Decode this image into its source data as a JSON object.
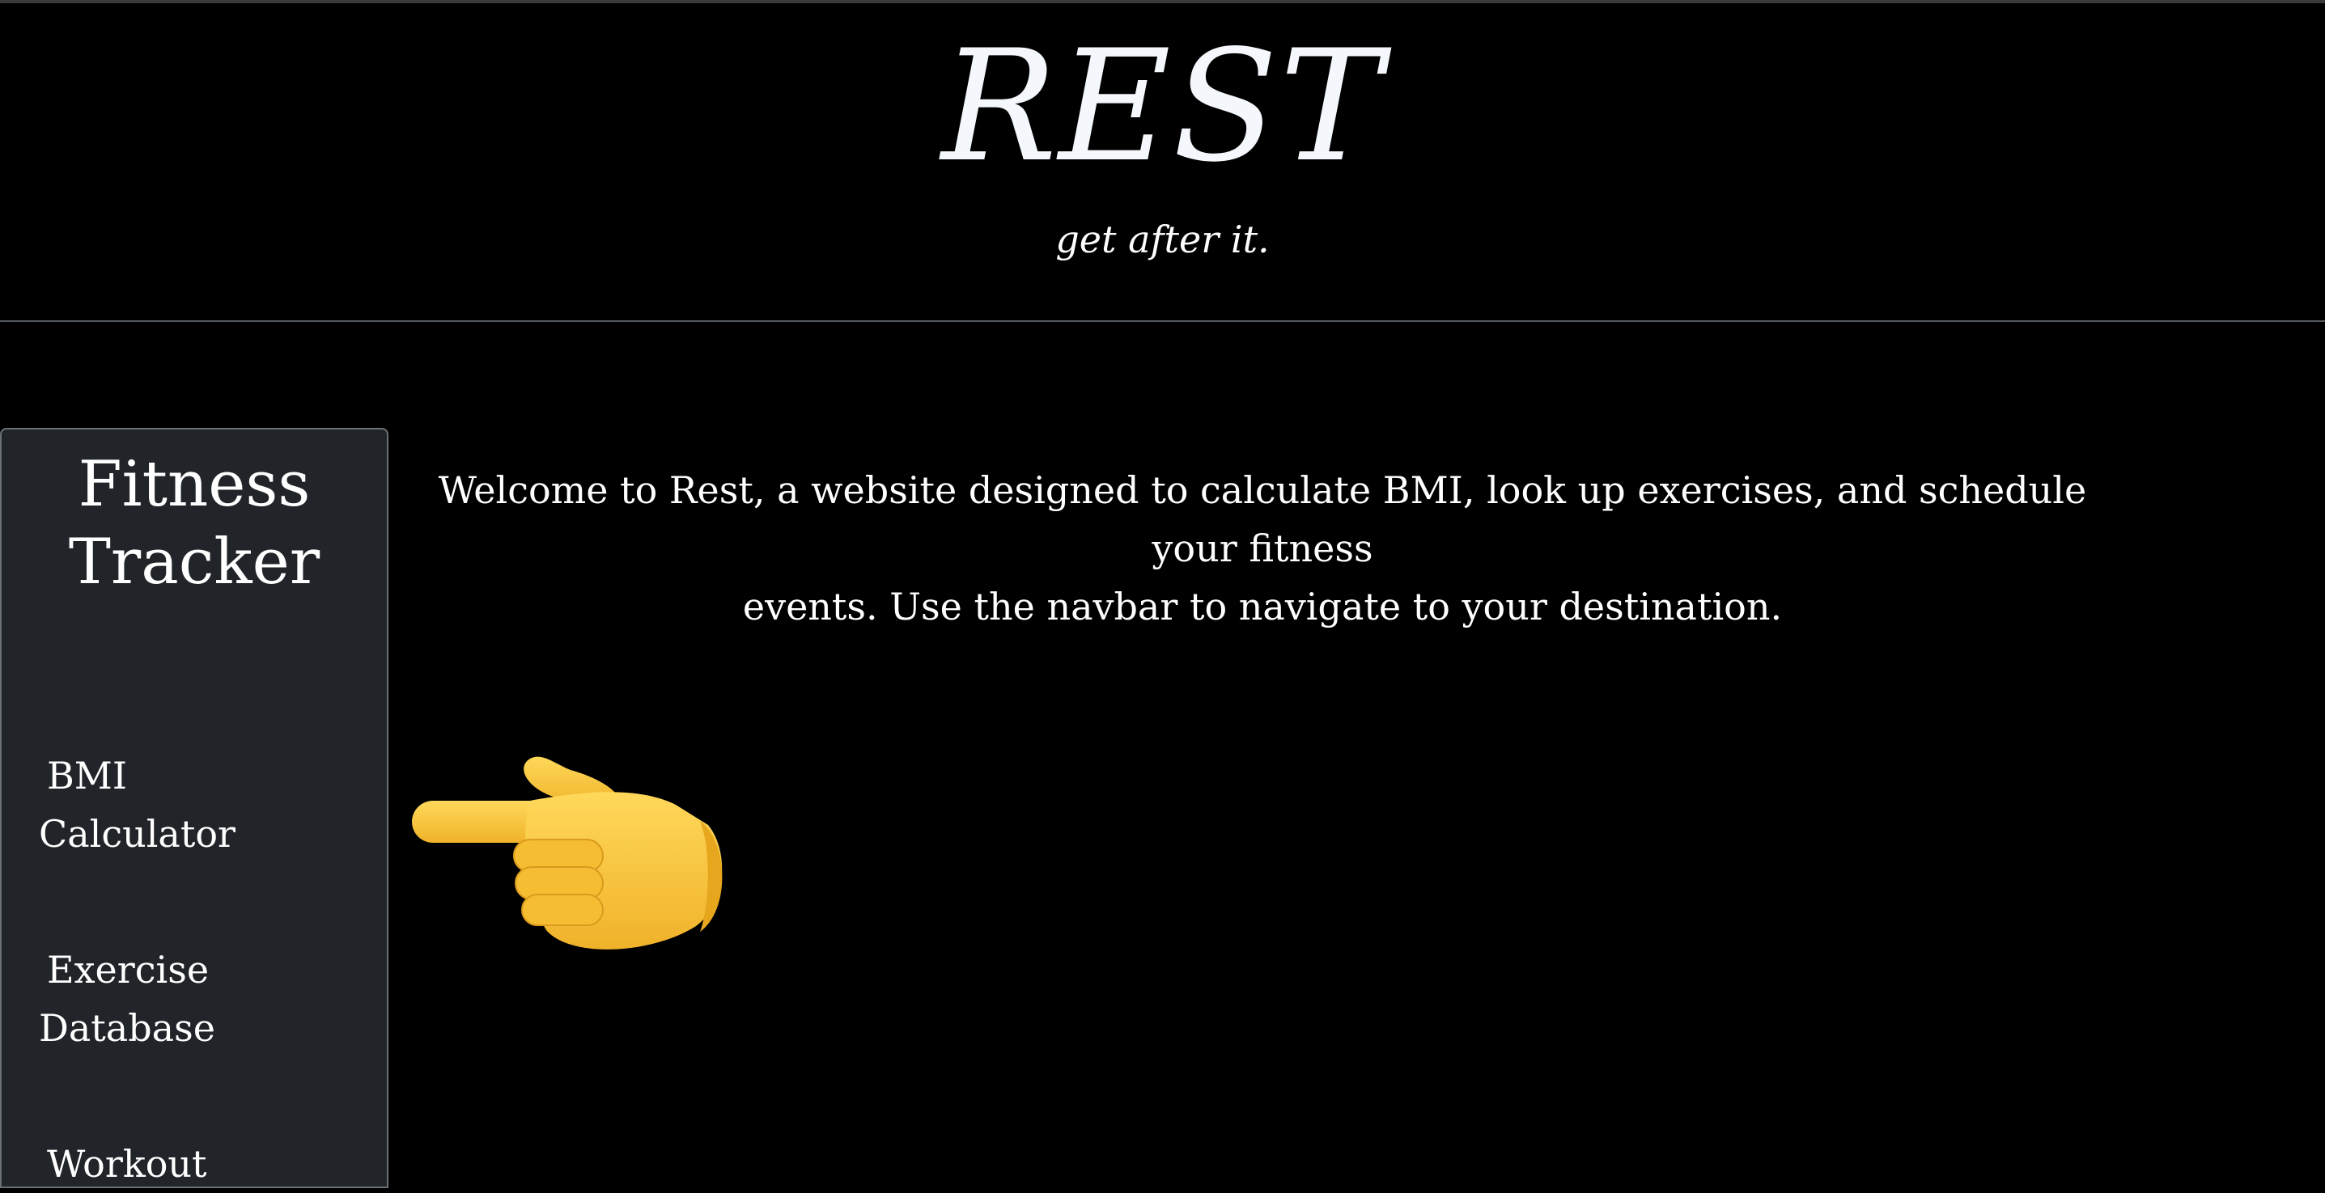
{
  "header": {
    "title": "REST",
    "tagline": "get after it."
  },
  "sidebar": {
    "title_line1": "Fitness",
    "title_line2": "Tracker",
    "items": [
      {
        "line1": "BMI",
        "line2": "Calculator"
      },
      {
        "line1": "Exercise",
        "line2": "Database"
      },
      {
        "line1": "Workout",
        "line2": ""
      }
    ]
  },
  "main": {
    "welcome_line1": "Welcome to Rest, a website designed to calculate BMI, look up exercises, and schedule your fitness",
    "welcome_line2": "events. Use the navbar to navigate to your destination.",
    "pointer_icon": "backhand-index-pointing-left-icon"
  },
  "colors": {
    "page_background": "#000000",
    "sidebar_background": "#212529",
    "text": "#ffffff",
    "emoji_skin": "#f7c336"
  }
}
